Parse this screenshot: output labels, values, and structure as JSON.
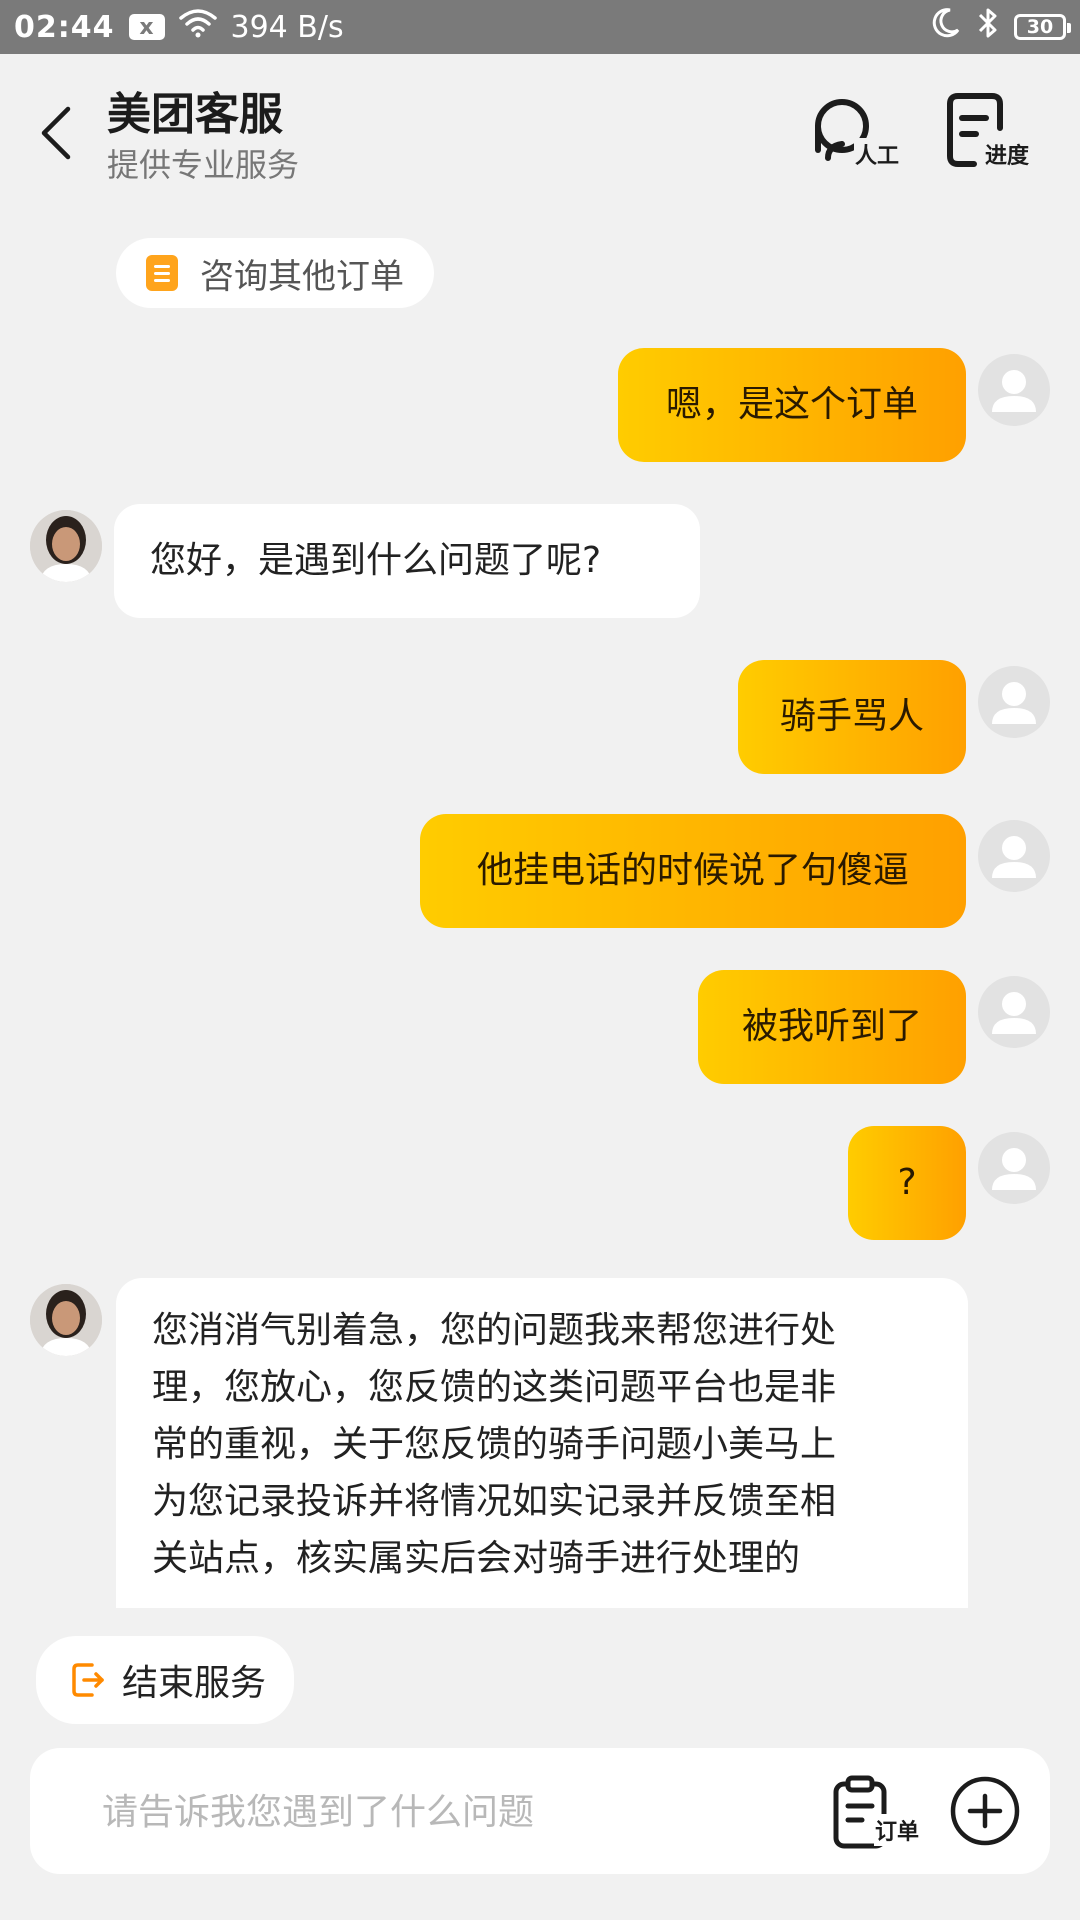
{
  "status_bar": {
    "time": "02:44",
    "notification_icon": "x",
    "speed": "394 B/s",
    "battery": "30"
  },
  "header": {
    "title": "美团客服",
    "subtitle": "提供专业服务",
    "staff_label": "人工",
    "progress_label": "进度"
  },
  "chips": {
    "other_order": "咨询其他订单",
    "end_service": "结束服务"
  },
  "messages": [
    {
      "from": "user",
      "text": "嗯，是这个订单"
    },
    {
      "from": "agent",
      "text": "您好，是遇到什么问题了呢?"
    },
    {
      "from": "user",
      "text": "骑手骂人"
    },
    {
      "from": "user",
      "text": "他挂电话的时候说了句傻逼"
    },
    {
      "from": "user",
      "text": "被我听到了"
    },
    {
      "from": "user",
      "text": "?"
    },
    {
      "from": "agent",
      "lines": [
        "您消消气别着急，您的问题我来帮您进行处",
        "理，您放心，您反馈的这类问题平台也是非",
        "常的重视，关于您反馈的骑手问题小美马上",
        "为您记录投诉并将情况如实记录并反馈至相",
        "关站点，核实属实后会对骑手进行处理的"
      ]
    }
  ],
  "input": {
    "placeholder": "请告诉我您遇到了什么问题",
    "order_label": "订单"
  },
  "colors": {
    "user_bubble_start": "#ffcc00",
    "user_bubble_end": "#ffa000",
    "accent_orange": "#ff8a00",
    "background": "#f1f1f1"
  }
}
